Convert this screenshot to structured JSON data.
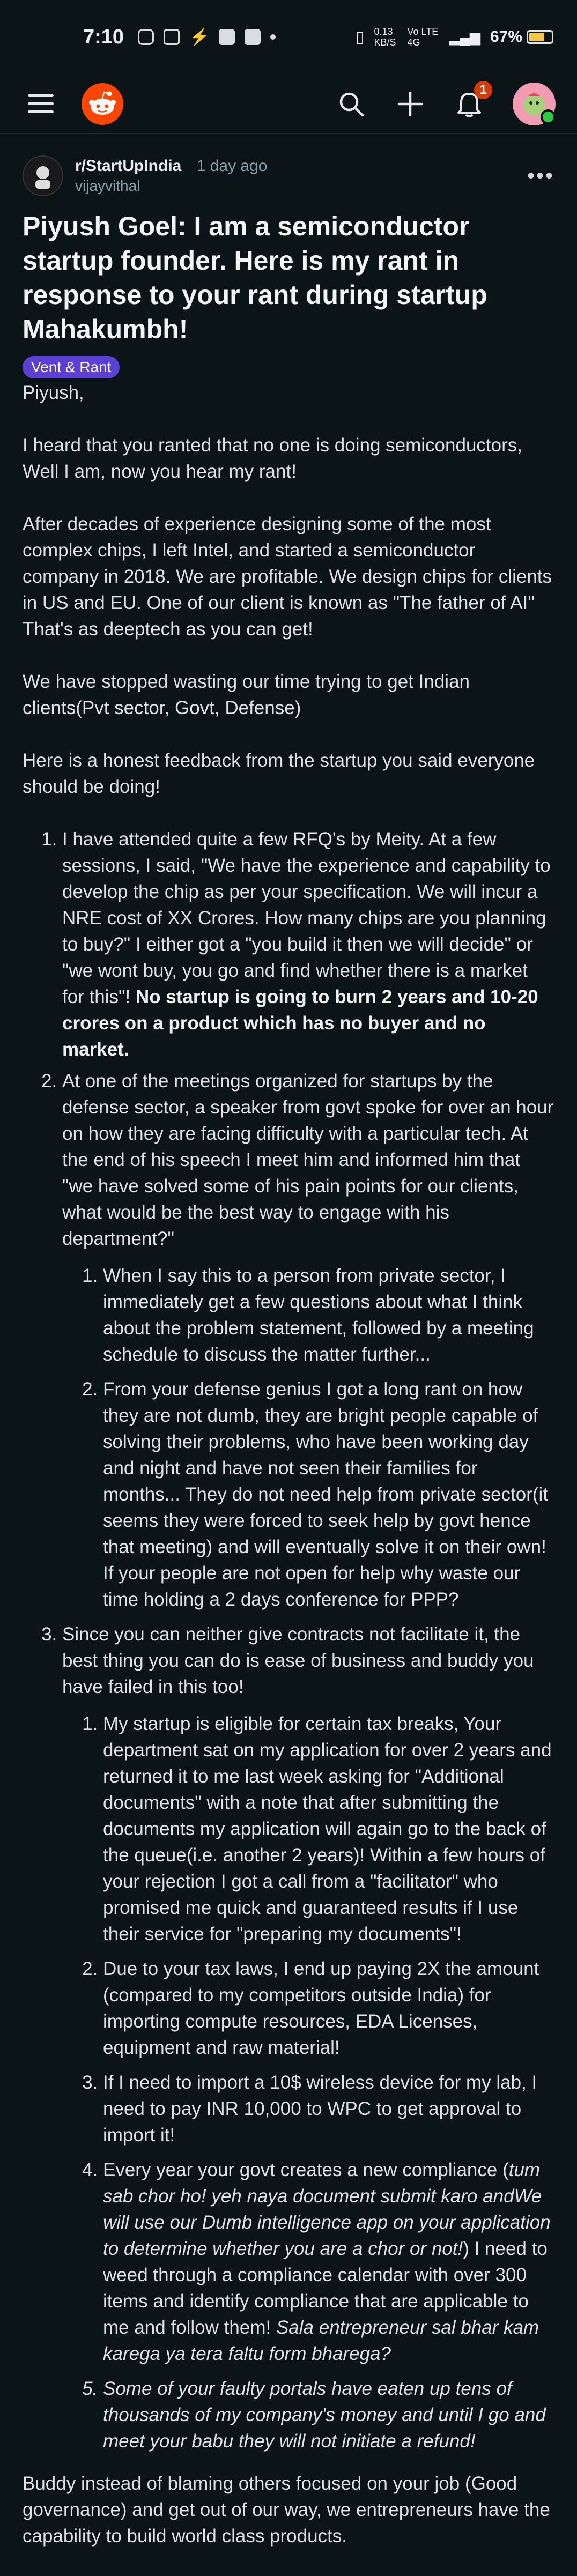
{
  "status_bar": {
    "time": "7:10",
    "net_speed": "0.13 KB/S",
    "network": "Vo LTE 4G",
    "battery_percent": "67%",
    "battery_level": 0.67,
    "battery_color": "#f6c844"
  },
  "header": {
    "menu_icon": "hamburger-icon",
    "logo_icon": "reddit-logo",
    "search_icon": "search-icon",
    "create_icon": "plus-icon",
    "notification_icon": "bell-icon",
    "notification_count": "1",
    "accent": "#ff4500"
  },
  "post": {
    "subreddit": "r/StartUpIndia",
    "time_ago": "1 day ago",
    "author": "vijayvithal",
    "title": "Piyush Goel: I am a semiconductor startup founder. Here is my rant in response to your rant during startup Mahakumbh!",
    "flair": "Vent & Rant",
    "flair_color": "#5b40d6",
    "greeting": "Piyush,",
    "p1": "I heard that you ranted that no one is doing semiconductors, Well I am, now you hear my rant!",
    "p2": "After decades of experience designing some of the most complex chips, I left Intel, and started a semiconductor company in 2018. We are profitable. We design chips for clients in US and EU. One of our client is known as \"The father of AI\" That's as deeptech as you can get!",
    "p3": "We have stopped wasting our time trying to get Indian clients(Pvt sector, Govt, Defense)",
    "p4": "Here is a honest feedback from the startup you said everyone should be doing!",
    "item1_text": "I have attended quite a few RFQ's by Meity. At a few sessions, I said, \"We have the experience and capability to develop the chip as per your specification. We will incur a NRE cost of XX Crores. How many chips are you planning to buy?\" I either got a \"you build it then we will decide\" or \"we wont buy, you go and find whether there is a market for this\"! ",
    "item1_bold": "No startup is going to burn 2 years and 10-20 crores on a product which has no buyer and no market.",
    "item2_text": "At one of the meetings organized for startups by the defense sector, a speaker from govt spoke for over an hour on how they are facing difficulty with a particular tech. At the end of his speech I meet him and informed him that \"we have solved some of his pain points for our clients, what would be the best way to engage with his department?\"",
    "item2_sub1": "When I say this to a person from private sector, I immediately get a few questions about what I think about the problem statement, followed by a meeting schedule to discuss the matter further...",
    "item2_sub2": "From your defense genius I got a long rant on how they are not dumb, they are bright people capable of solving their problems, who have been working day and night and have not seen their families for months... They do not need help from private sector(it seems they were forced to seek help by govt hence that meeting) and will eventually solve it on their own! If your people are not open for help why waste our time holding a 2 days conference for PPP?",
    "item3_text": "Since you can neither give contracts not facilitate it, the best thing you can do is ease of business and buddy you have failed in this too!",
    "item3_sub1": "My startup is eligible for certain tax breaks, Your department sat on my application for over 2 years and returned it to me last week asking for \"Additional documents\" with a note that after submitting the documents my application will again go to the back of the queue(i.e. another 2 years)! Within a few hours of your rejection I got a call from a \"facilitator\" who promised me quick and guaranteed results if I use their service for \"preparing my documents\"!",
    "item3_sub2": "Due to your tax laws, I end up paying 2X the amount (compared to my competitors outside India) for importing compute resources, EDA Licenses, equipment and raw material!",
    "item3_sub3": "If I need to import a 10$ wireless device for my lab, I need to pay INR 10,000 to WPC to get approval to import it!",
    "item3_sub4_a": "Every year your govt creates a new compliance (",
    "item3_sub4_b": "tum sab chor ho! yeh naya document submit karo andWe will use our Dumb intelligence app on your application to determine whether you are a chor or not!",
    "item3_sub4_c": ") I need to weed through a compliance calendar with over 300 items and identify compliance that are applicable to me and follow them! ",
    "item3_sub4_d": "Sala entrepreneur sal bhar kam karega ya tera faltu form bharega?",
    "item3_sub5": "Some of your faulty portals have eaten up tens of thousands of my company's money and until I go and meet your babu they will not initiate a refund!",
    "closing": "Buddy instead of blaming others focused on your job (Good governance) and get out of our way, we entrepreneurs have the capability to build world class products."
  }
}
